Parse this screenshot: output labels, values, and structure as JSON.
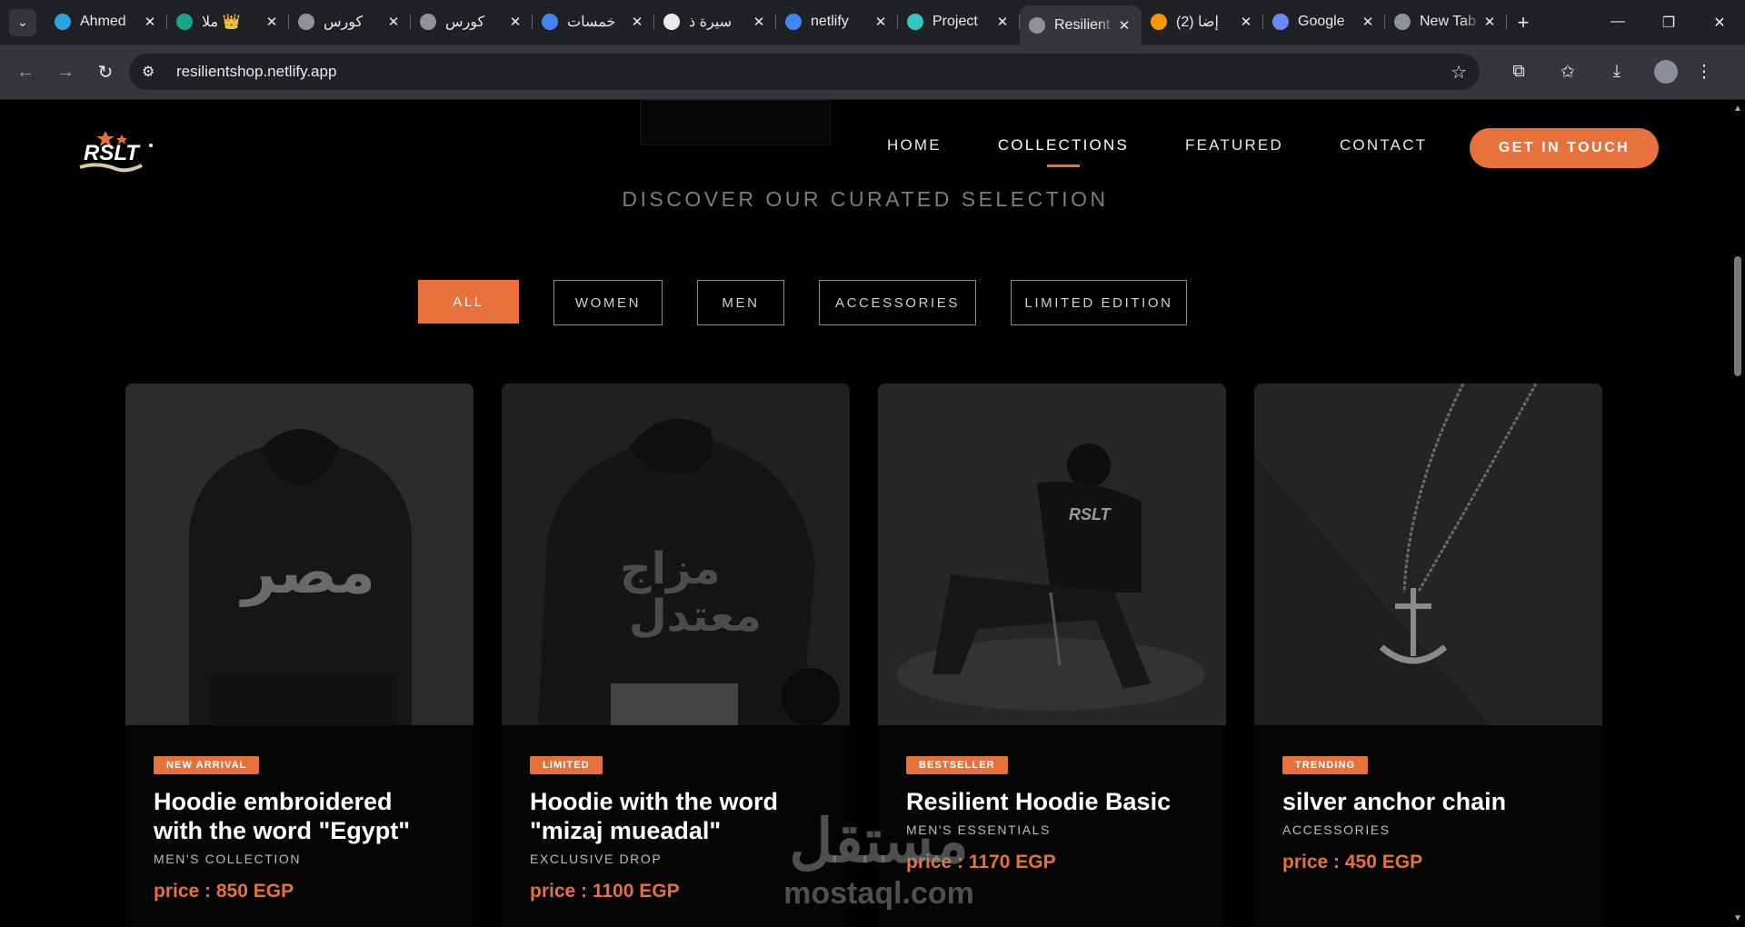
{
  "browser": {
    "tabs": [
      {
        "title": "Ahmed",
        "icon": "telegram-icon",
        "color": "#2aa3e1"
      },
      {
        "title": "ملا 👑",
        "icon": "app-icon",
        "color": "#17a589"
      },
      {
        "title": "كورس",
        "icon": "globe-icon",
        "color": "#8e9196"
      },
      {
        "title": "كورس",
        "icon": "globe-icon",
        "color": "#8e9196"
      },
      {
        "title": "خمسات",
        "icon": "google-icon",
        "color": "#4285f4"
      },
      {
        "title": "سيرة ذ",
        "icon": "chatgpt-icon",
        "color": "#e8eaed"
      },
      {
        "title": "netlify",
        "icon": "google-icon",
        "color": "#4285f4"
      },
      {
        "title": "Project",
        "icon": "netlify-icon",
        "color": "#32c5c1"
      },
      {
        "title": "Resilient",
        "icon": "globe-icon",
        "color": "#8e9196"
      },
      {
        "title": "(2) إضا",
        "icon": "notification-icon",
        "color": "#f29900"
      },
      {
        "title": "Google",
        "icon": "gemini-icon",
        "color": "#6b8cf7"
      },
      {
        "title": "New Tab",
        "icon": "chrome-icon",
        "color": "#8e9196"
      }
    ],
    "active_tab_index": 8,
    "url": "resilientshop.netlify.app"
  },
  "site": {
    "logo_text": "RSLT",
    "nav": [
      "HOME",
      "COLLECTIONS",
      "FEATURED",
      "CONTACT"
    ],
    "current_nav": "COLLECTIONS",
    "cta": "GET IN TOUCH",
    "section_title": "DISCOVER OUR CURATED SELECTION",
    "filters": [
      "ALL",
      "WOMEN",
      "MEN",
      "ACCESSORIES",
      "LIMITED EDITION"
    ],
    "active_filter": "ALL",
    "accent_color": "#e8703a",
    "products": [
      {
        "badge": "NEW ARRIVAL",
        "title": "Hoodie embroidered with the word \"Egypt\"",
        "category": "MEN'S COLLECTION",
        "price": "price : 850 EGP",
        "image": "black hoodie back with Arabic embroidery"
      },
      {
        "badge": "LIMITED",
        "title": "Hoodie with the word \"mizaj mueadal\"",
        "category": "EXCLUSIVE DROP",
        "price": "price : 1100 EGP",
        "image": "black hoodie back with Arabic print"
      },
      {
        "badge": "BESTSELLER",
        "title": "Resilient Hoodie Basic",
        "category": "MEN'S ESSENTIALS",
        "price": "price : 1170 EGP",
        "image": "model seated wearing black hoodie"
      },
      {
        "badge": "TRENDING",
        "title": "silver anchor chain",
        "category": "ACCESSORIES",
        "price": "price : 450 EGP",
        "image": "silver anchor pendant necklace"
      }
    ]
  },
  "watermark": {
    "arabic": "مستقل",
    "latin": "mostaql.com"
  }
}
